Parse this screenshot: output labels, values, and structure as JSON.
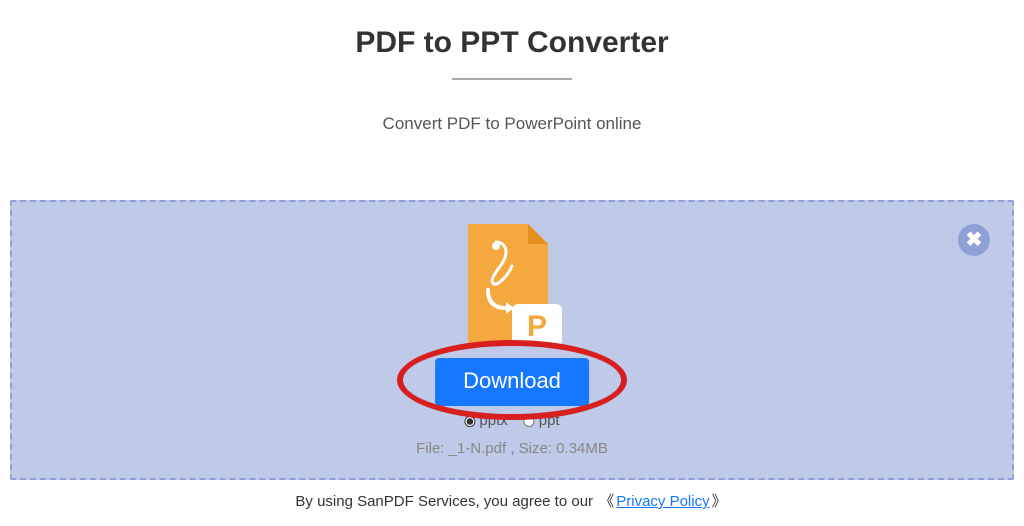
{
  "header": {
    "title": "PDF to PPT Converter",
    "subtitle": "Convert PDF to PowerPoint online"
  },
  "dropzone": {
    "download_label": "Download",
    "formats": {
      "pptx": "pptx",
      "ppt": "ppt",
      "selected": "pptx"
    },
    "file_info": "File: _1-N.pdf , Size: 0.34MB",
    "close_label": "✖"
  },
  "footer": {
    "prefix": "By using SanPDF Services, you agree to our ",
    "bracket_open": "《",
    "link_text": "Privacy Policy",
    "bracket_close": "》"
  }
}
